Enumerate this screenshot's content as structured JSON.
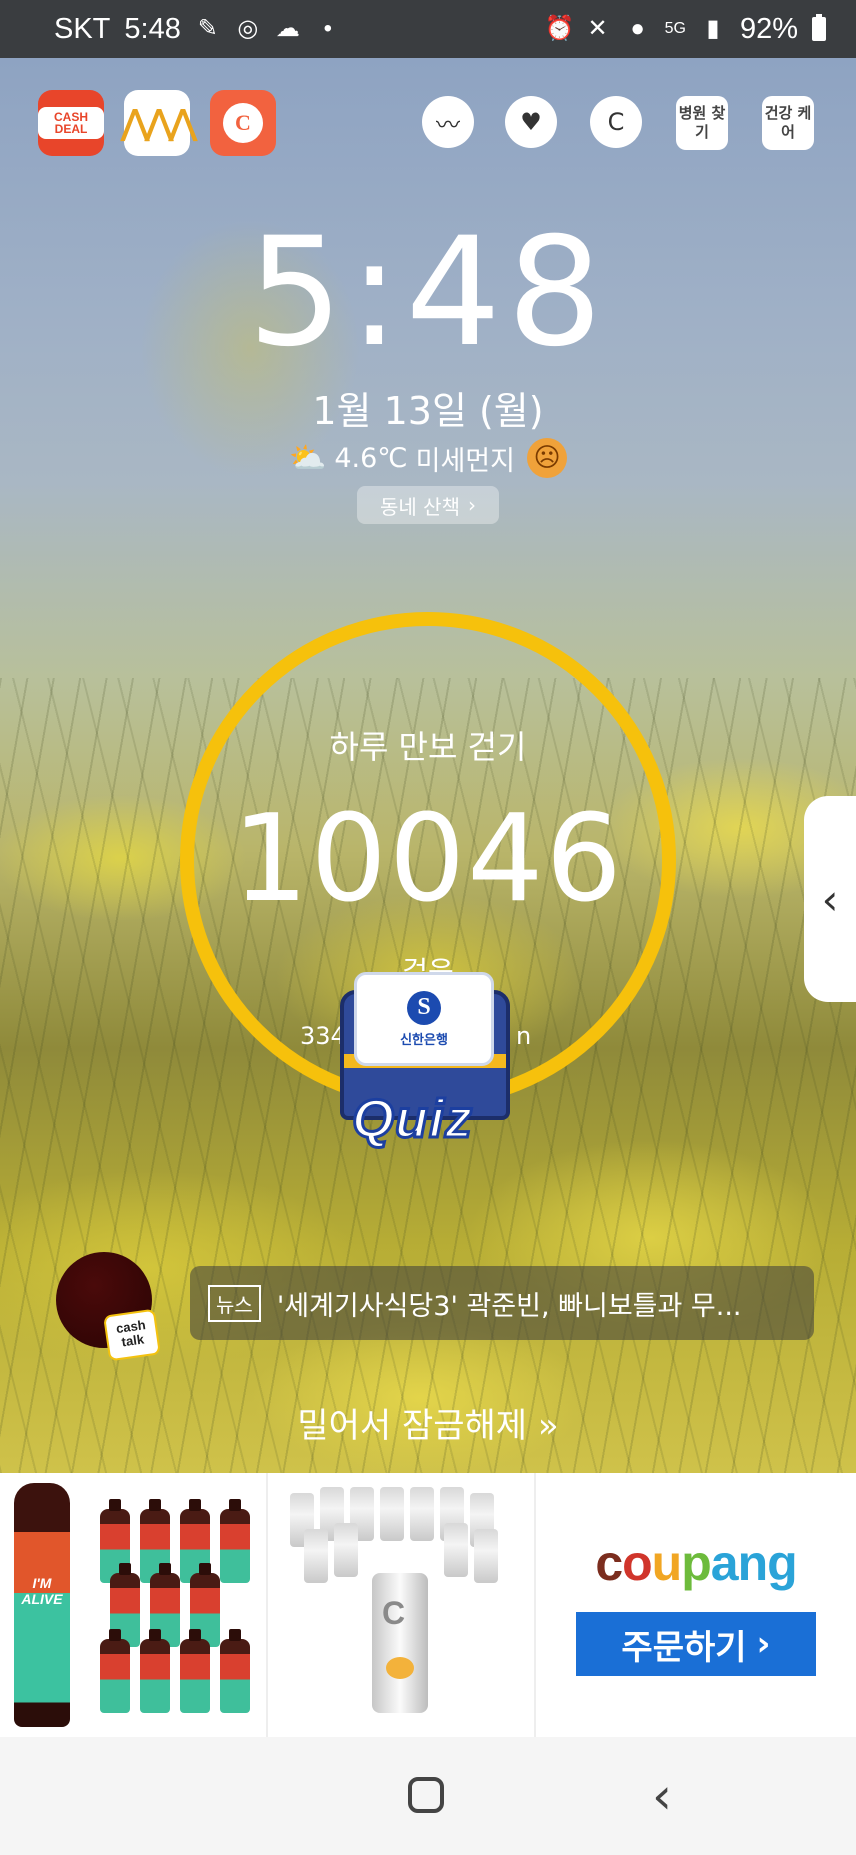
{
  "status_bar": {
    "carrier": "SKT",
    "time": "5:48",
    "network": "5G",
    "battery": "92%"
  },
  "shortcuts": {
    "cashdeal_label": "CASH DEAL",
    "health_find_hospital": "병원 찾기",
    "health_care": "건강 케어"
  },
  "lockscreen": {
    "clock": "5:48",
    "date": "1월 13일 (월)",
    "temperature": "4.6℃",
    "dust_label": "미세먼지",
    "walk_button": "동네 산책"
  },
  "steps": {
    "title": "하루 만보 걷기",
    "count": "10046",
    "unit": "걸음",
    "sub_left": "334",
    "sub_right": "n"
  },
  "quiz": {
    "bank": "신한은행",
    "label": "Quiz"
  },
  "cashtalk": {
    "label_top": "cash",
    "label_bottom": "talk"
  },
  "news": {
    "tag": "뉴스",
    "headline": "'세계기사식당3' 곽준빈, 빠니보틀과 무..."
  },
  "unlock_text": "밀어서 잠금해제",
  "ad": {
    "bottle_label": "I'M ALIVE",
    "can_label": "C",
    "brand": "coupang",
    "cta": "주문하기"
  },
  "colors": {
    "ring": "#f6c10c",
    "coupang_button": "#1a6fd6"
  }
}
